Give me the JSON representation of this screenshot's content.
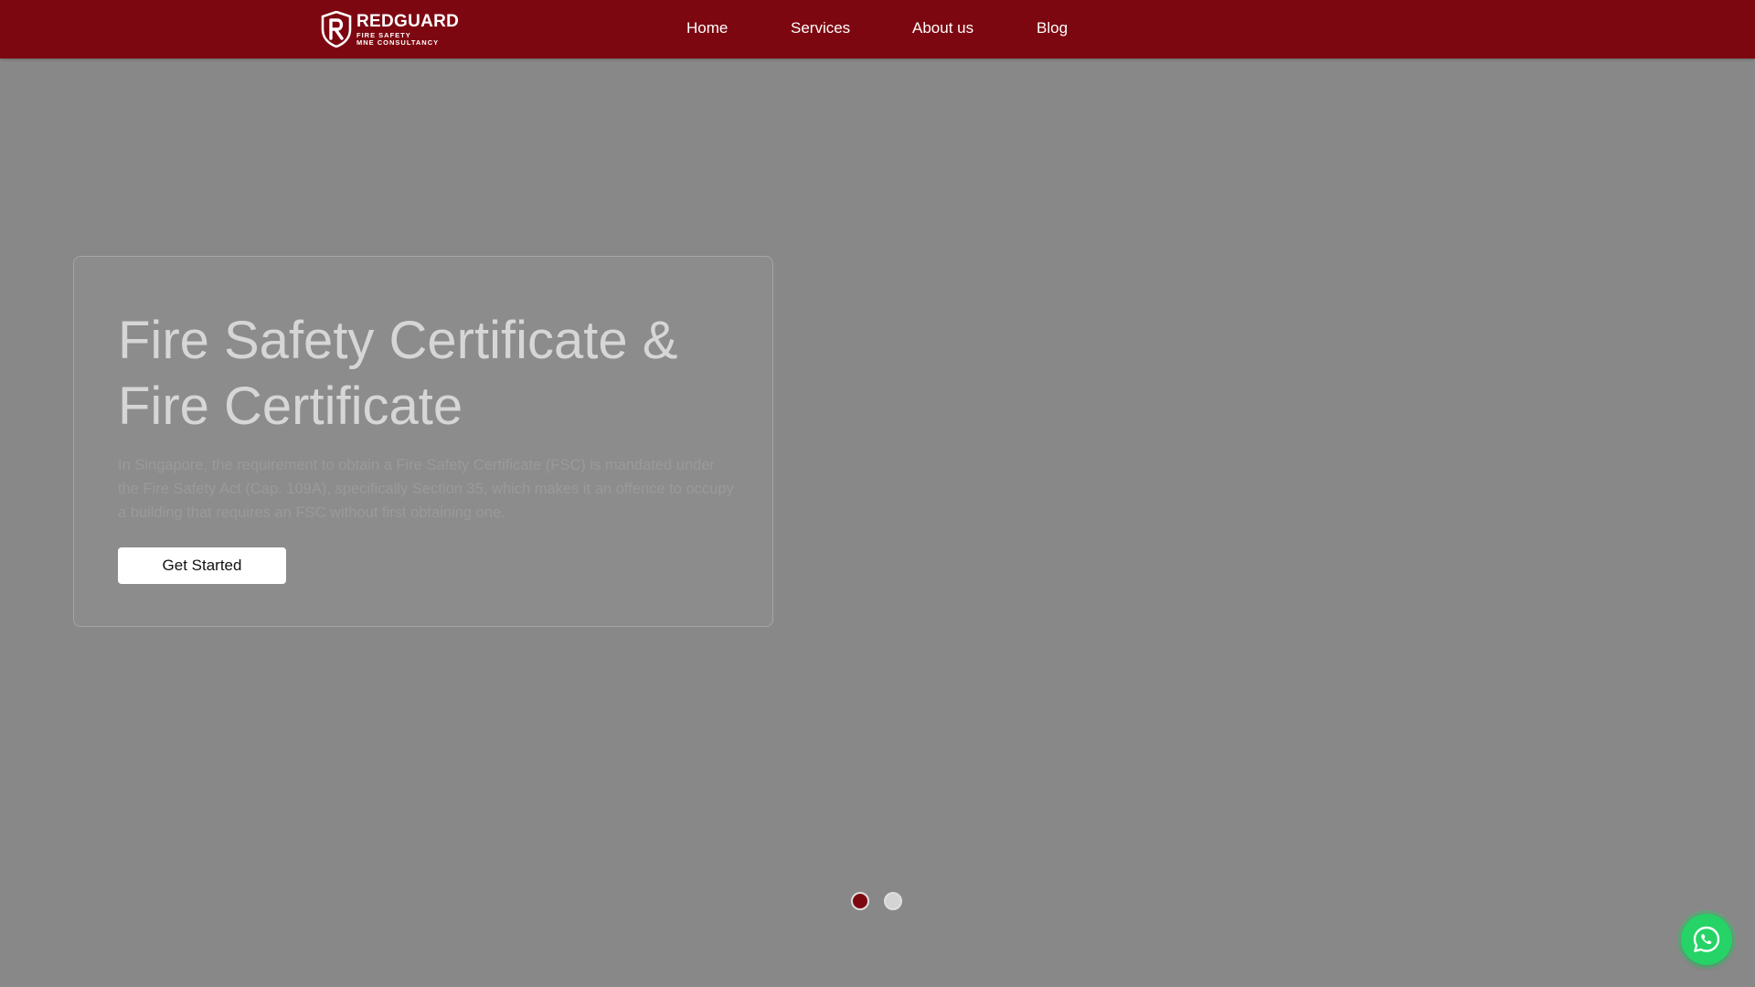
{
  "colors": {
    "brand": "#7d0710",
    "page_background": "#888888",
    "whatsapp": "#25d366"
  },
  "navbar": {
    "logo": {
      "name": "REDGUARD",
      "tagline_line1": "FIRE SAFETY",
      "tagline_line2": "MNE CONSULTANCY",
      "icon": "shield-r-logo-icon"
    },
    "links": [
      {
        "label": "Home"
      },
      {
        "label": "Services"
      },
      {
        "label": "About us"
      },
      {
        "label": "Blog"
      }
    ]
  },
  "hero": {
    "title": "Fire Safety Certificate & Fire Certificate",
    "description": "In Singapore, the requirement to obtain a Fire Safety Certificate (FSC) is mandated under the Fire Safety Act (Cap. 109A), specifically Section 35, which makes it an offence to occupy a building that requires an FSC without first obtaining one.",
    "cta_label": "Get Started"
  },
  "carousel": {
    "slide_count": 2,
    "active_index": 0
  },
  "floating": {
    "whatsapp_icon": "whatsapp-icon"
  }
}
